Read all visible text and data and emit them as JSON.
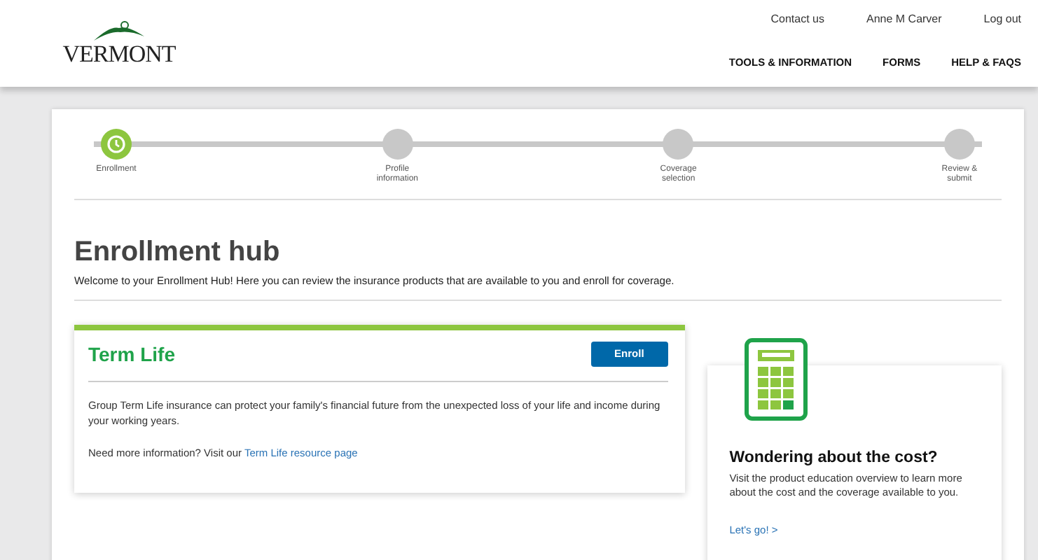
{
  "header": {
    "logo": "VERMONT",
    "utility_links": [
      "Contact us",
      "Anne M Carver",
      "Log out"
    ],
    "nav": [
      "TOOLS & INFORMATION",
      "FORMS",
      "HELP & FAQS"
    ]
  },
  "steps": [
    {
      "label": "Enrollment",
      "selected": true
    },
    {
      "label": "Profile information",
      "selected": false
    },
    {
      "label": "Coverage selection",
      "selected": false
    },
    {
      "label": "Review & submit",
      "selected": false
    }
  ],
  "title": "Enrollment hub",
  "intro": "Welcome to your Enrollment Hub! Here you can review the insurance products that are available to you and enroll for coverage.",
  "product": {
    "name": "Term Life",
    "button": "Enroll",
    "description": "Group Term Life insurance can protect your family's financial future from the unexpected loss of your life and income during your working years.",
    "more_text": "Need more information? Visit our",
    "more_link": "Term Life resource page"
  },
  "cost_card": {
    "title": "Wondering about the cost?",
    "text": "Visit the product education overview to learn more about the cost and the coverage available to you.",
    "link": "Let's go! >"
  }
}
